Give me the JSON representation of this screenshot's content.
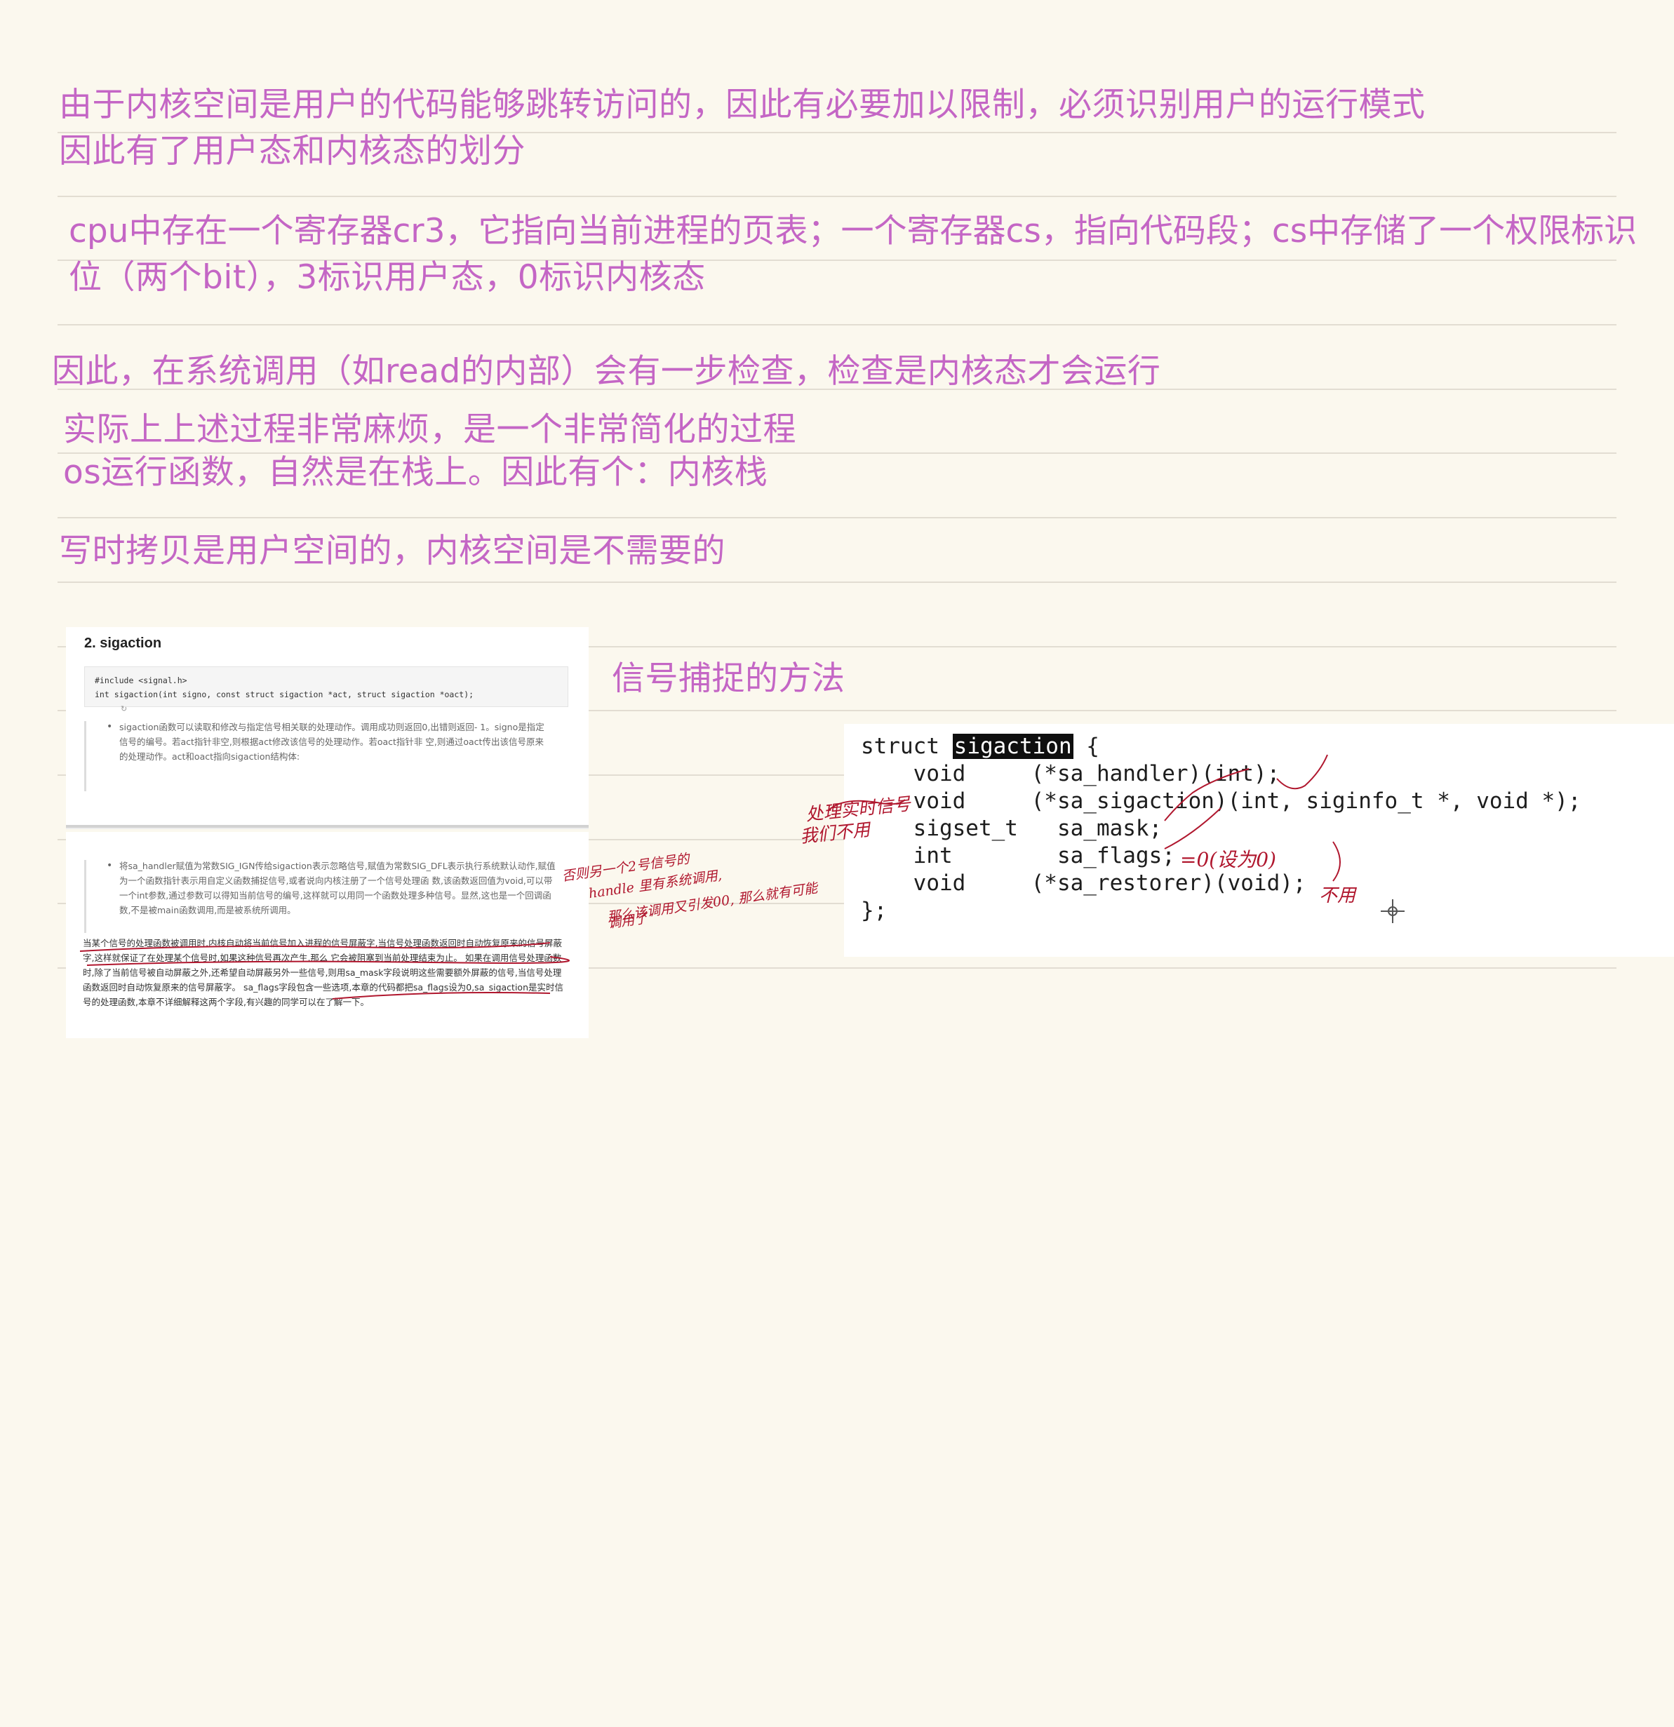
{
  "notes": {
    "line1": "由于内核空间是用户的代码能够跳转访问的，因此有必要加以限制，必须识别用户的运行模式",
    "line2": "因此有了用户态和内核态的划分",
    "line3": "cpu中存在一个寄存器cr3，它指向当前进程的页表；一个寄存器cs，指向代码段；cs中存储了一个权限标识",
    "line4": "位（两个bit），3标识用户态，0标识内核态",
    "line5": "因此，在系统调用（如read的内部）会有一步检查，检查是内核态才会运行",
    "line6": "实际上上述过程非常麻烦，是一个非常简化的过程",
    "line7": "os运行函数，自然是在栈上。因此有个：内核栈",
    "line8": "写时拷贝是用户空间的，内核空间是不需要的",
    "line9": "信号捕捉的方法"
  },
  "doc_shot": {
    "heading": "2. sigaction",
    "code_line1": "#include <signal.h>",
    "code_line2": "int sigaction(int signo, const struct sigaction *act, struct sigaction *oact);",
    "bullet1": "sigaction函数可以读取和修改与指定信号相关联的处理动作。调用成功则返回0,出错则返回- 1。signo是指定信号的编号。若act指针非空,则根据act修改该信号的处理动作。若oact指针非 空,则通过oact传出该信号原来的处理动作。act和oact指向sigaction结构体:",
    "bullet2": "将sa_handler赋值为常数SIG_IGN传给sigaction表示忽略信号,赋值为常数SIG_DFL表示执行系统默认动作,赋值为一个函数指针表示用自定义函数捕捉信号,或者说向内核注册了一个信号处理函 数,该函数返回值为void,可以带一个int参数,通过参数可以得知当前信号的编号,这样就可以用同一个函数处理多种信号。显然,这也是一个回调函数,不是被main函数调用,而是被系统所调用。",
    "para": "当某个信号的处理函数被调用时,内核自动将当前信号加入进程的信号屏蔽字,当信号处理函数返回时自动恢复原来的信号屏蔽字,这样就保证了在处理某个信号时,如果这种信号再次产生,那么 它会被阻塞到当前处理结束为止。 如果在调用信号处理函数时,除了当前信号被自动屏蔽之外,还希望自动屏蔽另外一些信号,则用sa_mask字段说明这些需要额外屏蔽的信号,当信号处理函数返回时自动恢复原来的信号屏蔽字。 sa_flags字段包含一些选项,本章的代码都把sa_flags设为0,sa_sigaction是实时信号的处理函数,本章不详细解释这两个字段,有兴趣的同学可以在了解一下。",
    "handwriting": [
      "否则另一个2号信号的",
      "handle 里有系统调用,",
      "那么该调用又引发00, 那么就有可能",
      "调用了"
    ]
  },
  "code_shot": {
    "line1_pre": "struct ",
    "line1_hl": "sigaction",
    "line1_post": " {",
    "line2": "    void     (*sa_handler)(int);",
    "line3": "    void     (*sa_sigaction)(int, siginfo_t *, void *);",
    "line4": "    sigset_t   sa_mask;",
    "line5": "    int        sa_flags;",
    "line6": "    void     (*sa_restorer)(void);",
    "line7": "};",
    "ann_left": [
      "处理实时信号",
      "我们不用"
    ],
    "ann_flags": "=0(设为0)",
    "ann_restorer": "不用"
  }
}
